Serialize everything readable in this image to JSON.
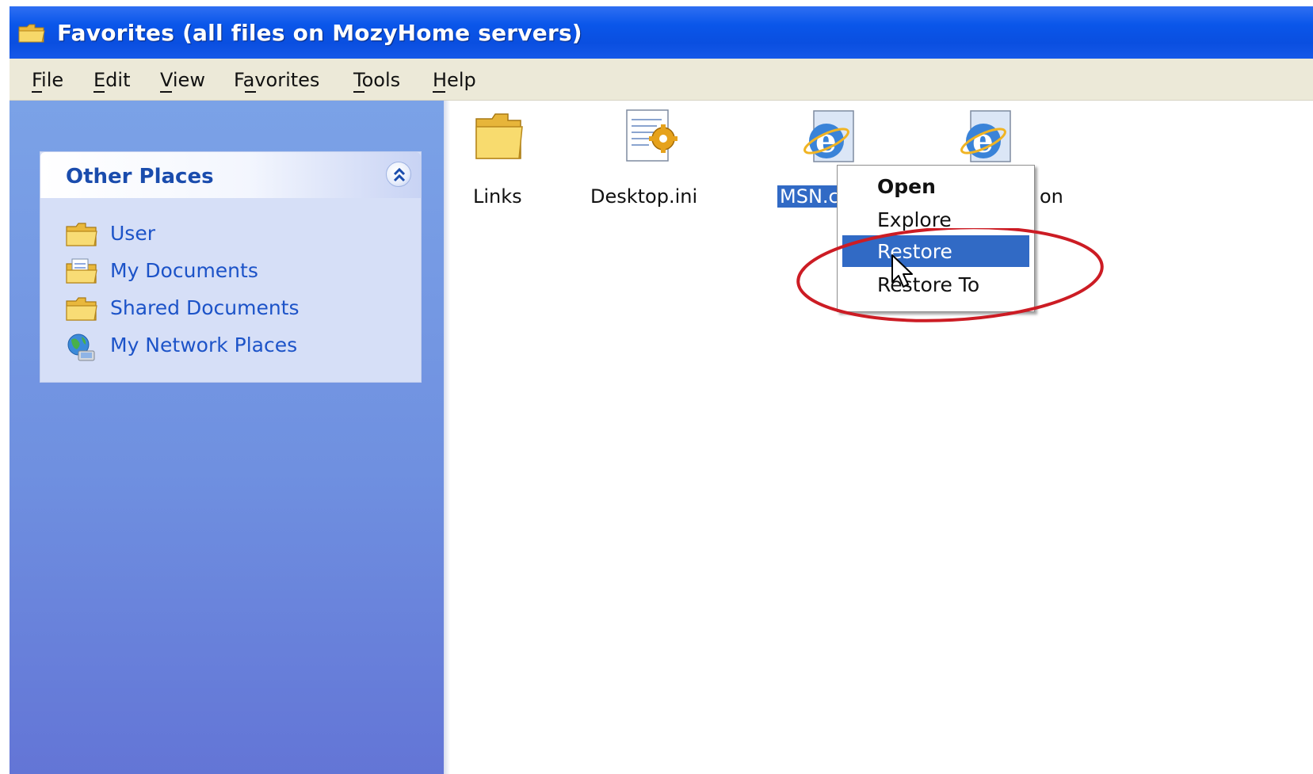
{
  "window": {
    "title": "Favorites (all files on MozyHome servers)",
    "title_icon": "folder-icon"
  },
  "menu": {
    "items": [
      {
        "label": "File",
        "mnemonic": "F"
      },
      {
        "label": "Edit",
        "mnemonic": "E"
      },
      {
        "label": "View",
        "mnemonic": "V"
      },
      {
        "label": "Favorites",
        "mnemonic": "a"
      },
      {
        "label": "Tools",
        "mnemonic": "T"
      },
      {
        "label": "Help",
        "mnemonic": "H"
      }
    ]
  },
  "sidebar": {
    "panel_title": "Other Places",
    "collapse_icon": "chevron-up-double-icon",
    "items": [
      {
        "label": "User",
        "icon": "folder-icon"
      },
      {
        "label": "My Documents",
        "icon": "documents-folder-icon"
      },
      {
        "label": "Shared Documents",
        "icon": "folder-icon"
      },
      {
        "label": "My Network Places",
        "icon": "network-places-icon"
      }
    ]
  },
  "files": {
    "items": [
      {
        "label": "Links",
        "icon": "folder-icon",
        "selected": false
      },
      {
        "label": "Desktop.ini",
        "icon": "settings-file-icon",
        "selected": false
      },
      {
        "label": "MSN.c",
        "icon": "internet-shortcut-icon",
        "selected": true
      },
      {
        "label": "on",
        "icon": "internet-shortcut-icon",
        "selected": false
      }
    ]
  },
  "context_menu": {
    "items": [
      {
        "label": "Open",
        "bold": true,
        "highlighted": false
      },
      {
        "label": "Explore",
        "bold": false,
        "highlighted": false
      },
      {
        "label": "Restore",
        "bold": false,
        "highlighted": true
      },
      {
        "label": "Restore To",
        "bold": false,
        "highlighted": false
      }
    ],
    "highlight_color": "#316ac5",
    "annotation_color": "#cc1c24"
  },
  "colors": {
    "titlebar": "#0a56ea",
    "menubar": "#ece9d8",
    "sidebar": "#6f90e0",
    "link": "#1c53c8"
  }
}
